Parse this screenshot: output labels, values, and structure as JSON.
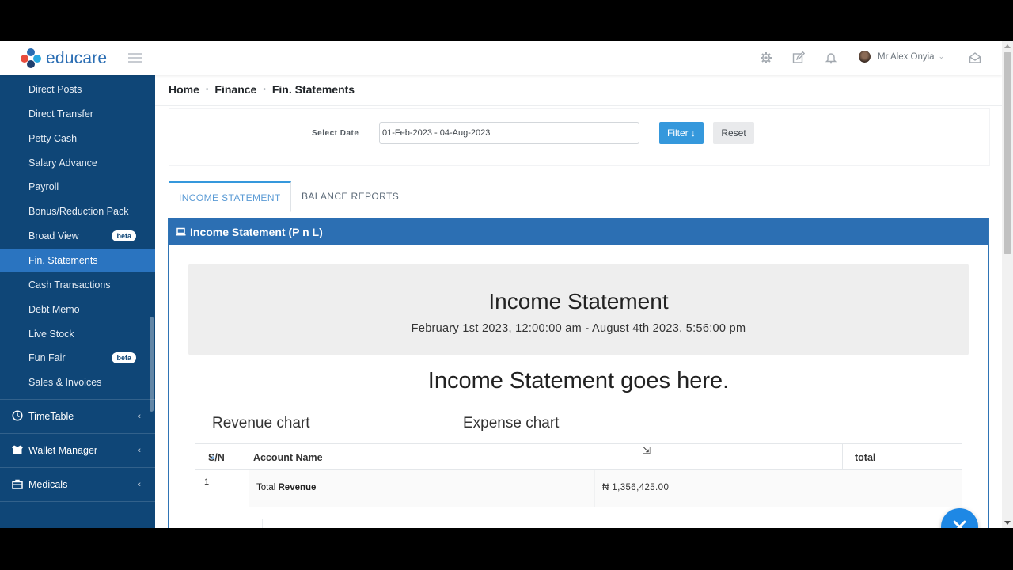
{
  "header": {
    "brand": "educare",
    "user_name": "Mr Alex Onyia",
    "icons": [
      "gear-icon",
      "edit-icon",
      "bell-icon",
      "inbox-icon"
    ]
  },
  "sidebar": {
    "items": [
      {
        "label": "Direct Posts"
      },
      {
        "label": "Direct Transfer"
      },
      {
        "label": "Petty Cash"
      },
      {
        "label": "Salary Advance"
      },
      {
        "label": "Payroll"
      },
      {
        "label": "Bonus/Reduction Pack"
      },
      {
        "label": "Broad View",
        "badge": "beta"
      },
      {
        "label": "Fin. Statements",
        "active": true
      },
      {
        "label": "Cash Transactions"
      },
      {
        "label": "Debt Memo"
      },
      {
        "label": "Live Stock"
      },
      {
        "label": "Fun Fair",
        "badge": "beta"
      },
      {
        "label": "Sales & Invoices"
      }
    ],
    "groups": [
      {
        "label": "TimeTable",
        "icon": "clock-icon"
      },
      {
        "label": "Wallet Manager",
        "icon": "wallet-icon"
      },
      {
        "label": "Medicals",
        "icon": "briefcase-icon"
      }
    ]
  },
  "breadcrumb": [
    "Home",
    "Finance",
    "Fin. Statements"
  ],
  "filter": {
    "label": "Select Date",
    "date_range": "01-Feb-2023 - 04-Aug-2023",
    "filter_button": "Filter ↓",
    "reset_button": "Reset"
  },
  "tabs": [
    {
      "label": "INCOME STATEMENT",
      "active": true
    },
    {
      "label": "BALANCE REPORTS"
    }
  ],
  "panel": {
    "title": "Income Statement (P n L)",
    "heading": "Income Statement",
    "period": "February 1st 2023, 12:00:00 am - August 4th 2023, 5:56:00 pm",
    "placeholder": "Income Statement goes here.",
    "revenue_chart_title": "Revenue chart",
    "expense_chart_title": "Expense chart"
  },
  "table": {
    "columns": [
      "S/N",
      "Account Name",
      "total"
    ],
    "rows": [
      {
        "sn": "1",
        "label_prefix": "Total",
        "label_bold": "Revenue",
        "amount": "₦ 1,356,425.00"
      }
    ]
  },
  "colors": {
    "sidebar_bg": "#0f4677",
    "sidebar_active": "#2a74c0",
    "panel_header": "#2c6fb3",
    "primary_button": "#3598dc",
    "fab": "#1e88e5"
  }
}
